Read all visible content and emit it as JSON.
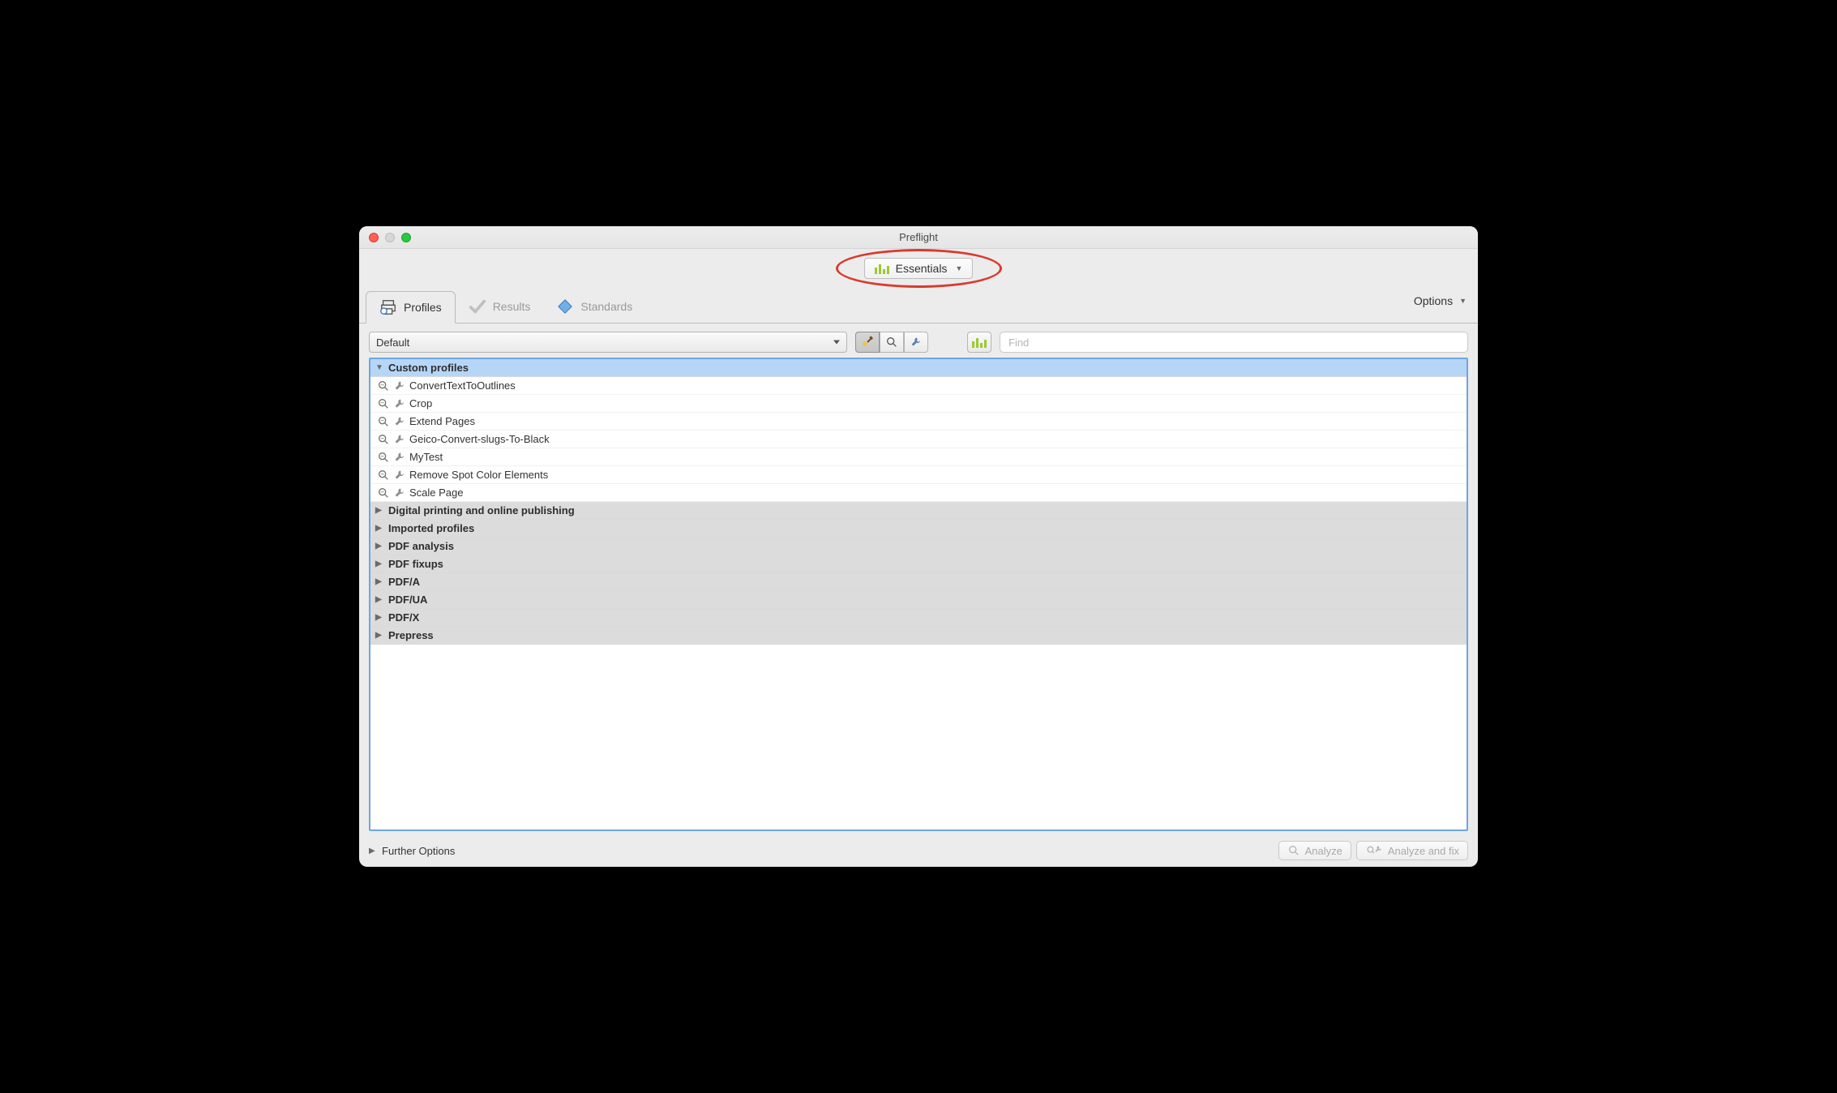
{
  "window": {
    "title": "Preflight"
  },
  "library": {
    "label": "Essentials"
  },
  "tabs": {
    "profiles": "Profiles",
    "results": "Results",
    "standards": "Standards"
  },
  "options_label": "Options",
  "dropdown_default": "Default",
  "find_placeholder": "Find",
  "groups": [
    {
      "name": "Custom profiles",
      "expanded": true,
      "items": [
        "ConvertTextToOutlines",
        "Crop",
        "Extend Pages",
        "Geico-Convert-slugs-To-Black",
        "MyTest",
        "Remove Spot Color Elements",
        "Scale Page"
      ]
    },
    {
      "name": "Digital printing and online publishing",
      "expanded": false,
      "items": []
    },
    {
      "name": "Imported profiles",
      "expanded": false,
      "items": []
    },
    {
      "name": "PDF analysis",
      "expanded": false,
      "items": []
    },
    {
      "name": "PDF fixups",
      "expanded": false,
      "items": []
    },
    {
      "name": "PDF/A",
      "expanded": false,
      "items": []
    },
    {
      "name": "PDF/UA",
      "expanded": false,
      "items": []
    },
    {
      "name": "PDF/X",
      "expanded": false,
      "items": []
    },
    {
      "name": "Prepress",
      "expanded": false,
      "items": []
    }
  ],
  "footer": {
    "further_options": "Further Options",
    "analyze": "Analyze",
    "analyze_fix": "Analyze and fix"
  }
}
